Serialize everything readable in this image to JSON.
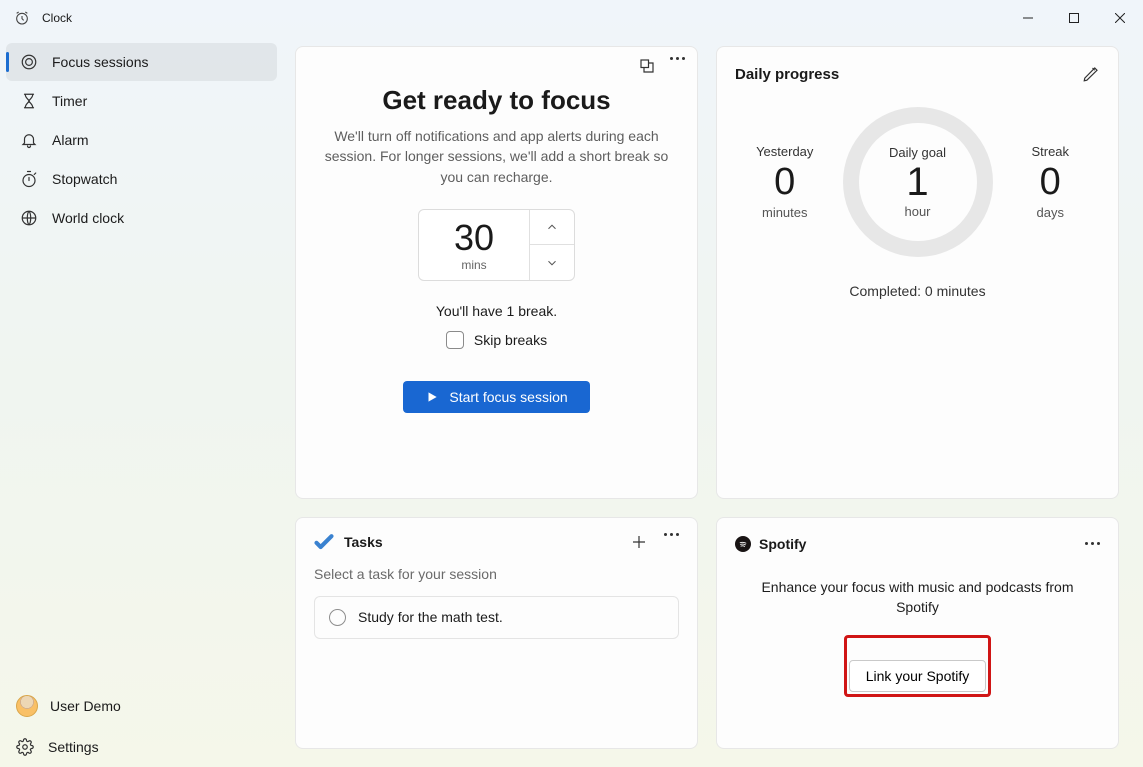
{
  "app": {
    "title": "Clock"
  },
  "sidebar": {
    "items": [
      {
        "label": "Focus sessions"
      },
      {
        "label": "Timer"
      },
      {
        "label": "Alarm"
      },
      {
        "label": "Stopwatch"
      },
      {
        "label": "World clock"
      }
    ],
    "selected_index": 0,
    "user_label": "User Demo",
    "settings_label": "Settings"
  },
  "focus": {
    "title": "Get ready to focus",
    "description": "We'll turn off notifications and app alerts during each session. For longer sessions, we'll add a short break so you can recharge.",
    "duration_value": "30",
    "duration_unit": "mins",
    "breaks_line": "You'll have 1 break.",
    "skip_label": "Skip breaks",
    "start_label": "Start focus session"
  },
  "tasks": {
    "title": "Tasks",
    "hint": "Select a task for your session",
    "items": [
      {
        "text": "Study for the math test."
      }
    ]
  },
  "progress": {
    "title": "Daily progress",
    "yesterday": {
      "label": "Yesterday",
      "value": "0",
      "unit": "minutes"
    },
    "goal": {
      "label": "Daily goal",
      "value": "1",
      "unit": "hour"
    },
    "streak": {
      "label": "Streak",
      "value": "0",
      "unit": "days"
    },
    "completed_line": "Completed: 0 minutes"
  },
  "spotify": {
    "brand": "Spotify",
    "desc": "Enhance your focus with music and podcasts from Spotify",
    "link_label": "Link your Spotify"
  }
}
